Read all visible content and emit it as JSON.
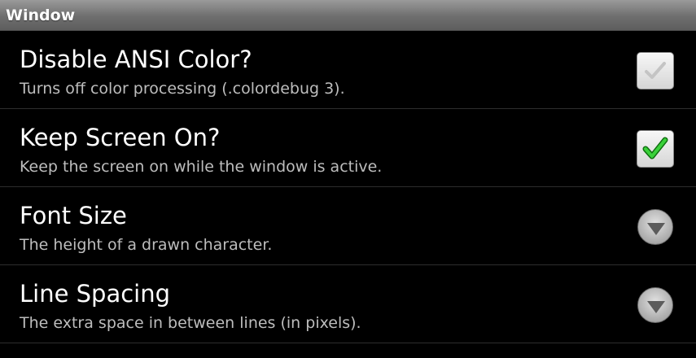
{
  "category": {
    "title": "Window"
  },
  "preferences": [
    {
      "title": "Disable ANSI Color?",
      "summary": "Turns off color processing (.colordebug 3).",
      "widget": "checkbox",
      "checked": false,
      "icon": "check-icon-unchecked"
    },
    {
      "title": "Keep Screen On?",
      "summary": "Keep the screen on while the window is active.",
      "widget": "checkbox",
      "checked": true,
      "icon": "check-icon-checked"
    },
    {
      "title": "Font Size",
      "summary": "The height of a drawn character.",
      "widget": "dropdown",
      "icon": "chevron-down-icon"
    },
    {
      "title": "Line Spacing",
      "summary": "The extra space in between lines (in pixels).",
      "widget": "dropdown",
      "icon": "chevron-down-icon"
    }
  ],
  "colors": {
    "background": "#000000",
    "header_gradient_top": "#9a9a9a",
    "header_gradient_bottom": "#5e5e5e",
    "title_text": "#ffffff",
    "summary_text": "#bdbdbd",
    "check_active": "#2db82d",
    "check_inactive": "#c8c8c8",
    "divider": "#2d2d2d"
  }
}
